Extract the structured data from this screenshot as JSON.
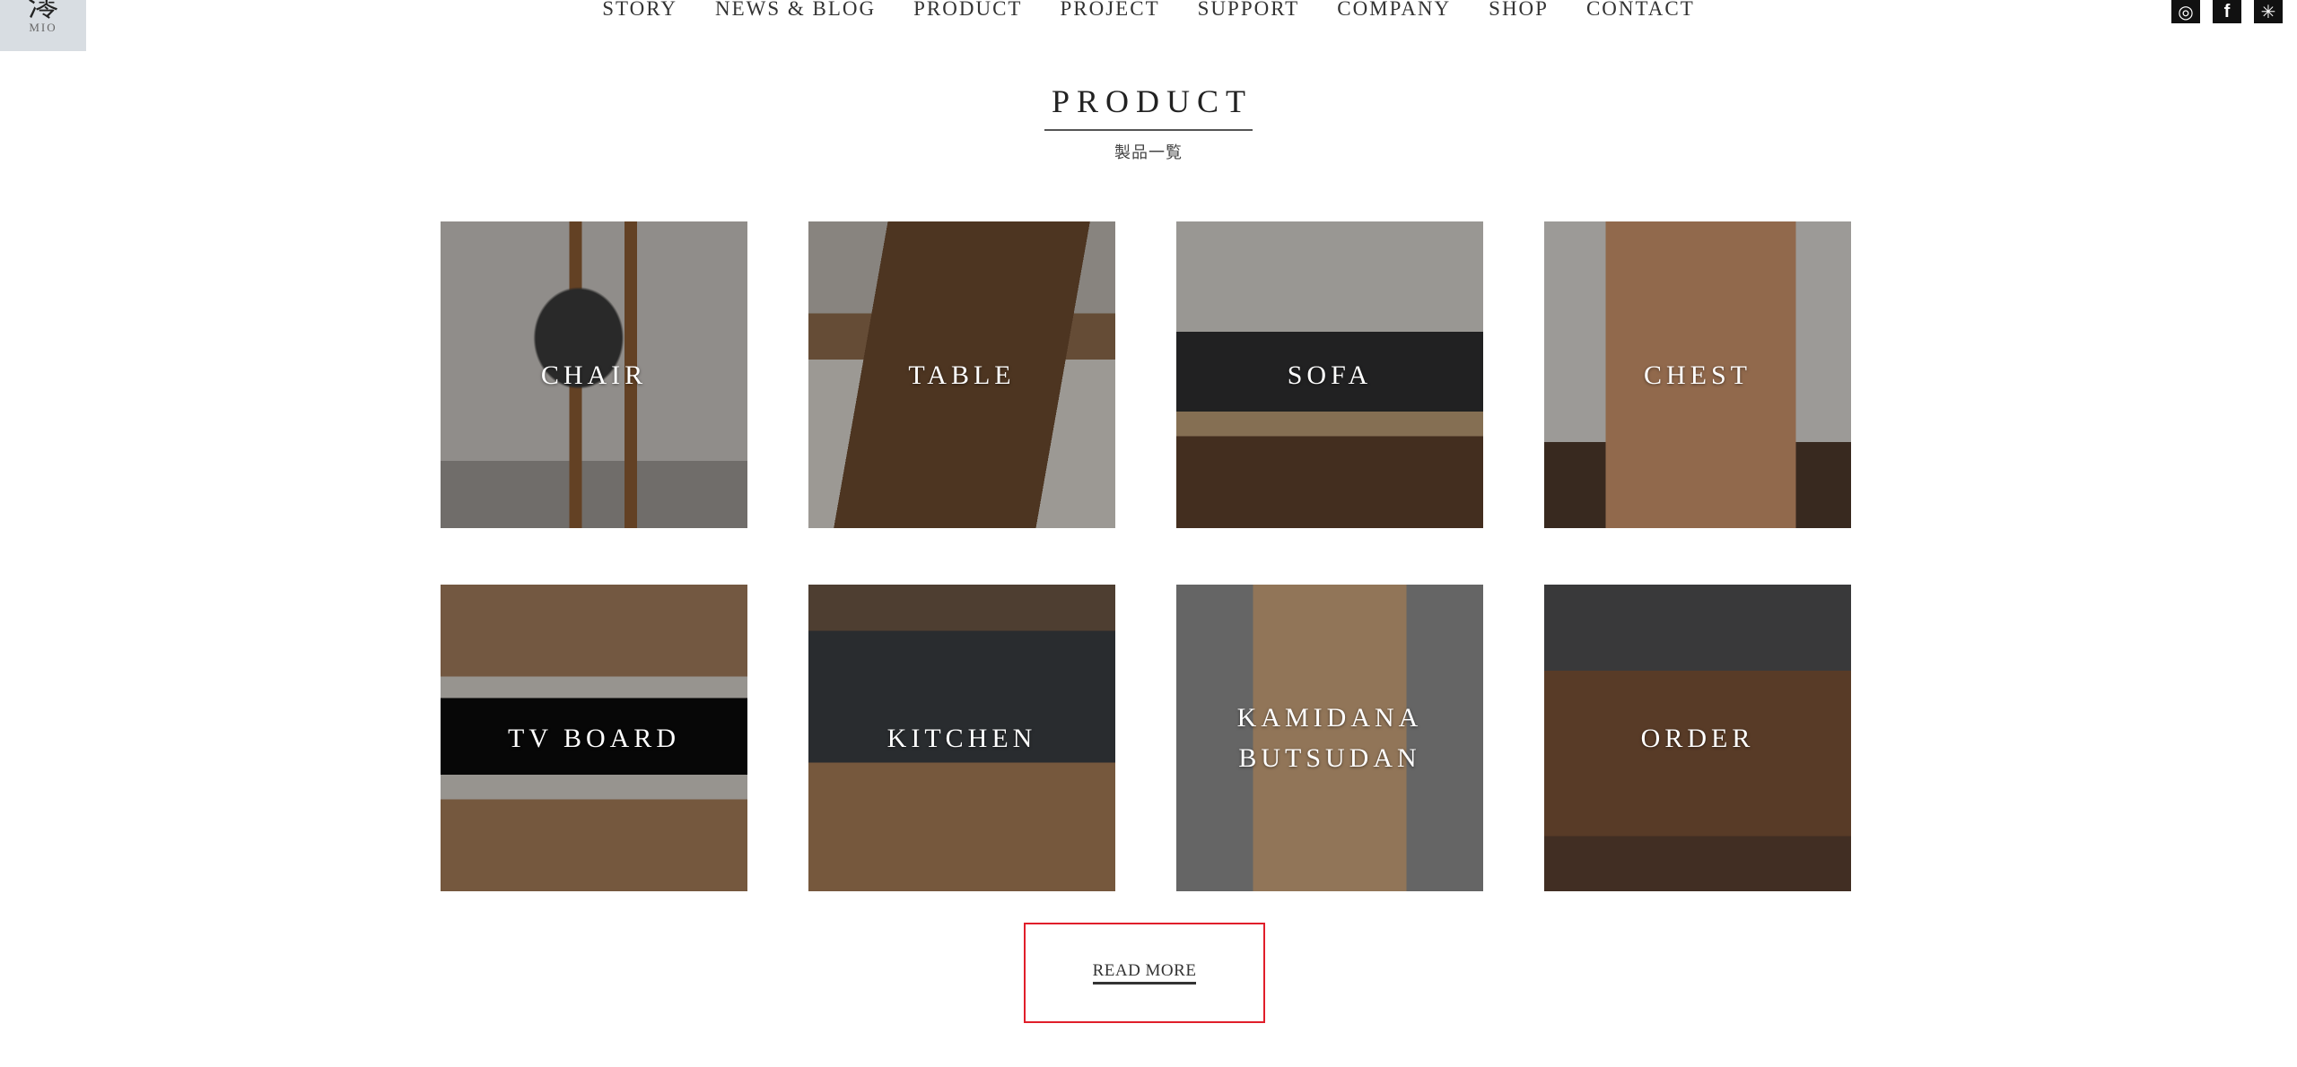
{
  "logo": {
    "mark": "澪",
    "sub": "MIO"
  },
  "nav": [
    "STORY",
    "NEWS & BLOG",
    "PRODUCT",
    "PROJECT",
    "SUPPORT",
    "COMPANY",
    "SHOP",
    "CONTACT"
  ],
  "social": [
    {
      "icon": "instagram-icon",
      "glyph": "◎"
    },
    {
      "icon": "facebook-icon",
      "glyph": "f"
    },
    {
      "icon": "snowflake-icon",
      "glyph": "✳"
    }
  ],
  "section": {
    "title": "PRODUCT",
    "subtitle": "製品一覧"
  },
  "products": [
    {
      "label": "CHAIR",
      "style": "p1"
    },
    {
      "label": "TABLE",
      "style": "p2"
    },
    {
      "label": "SOFA",
      "style": "p3"
    },
    {
      "label": "CHEST",
      "style": "p4"
    },
    {
      "label": "TV BOARD",
      "style": "p5"
    },
    {
      "label": "KITCHEN",
      "style": "p6"
    },
    {
      "label": "KAMIDANA\nBUTSUDAN",
      "style": "p7"
    },
    {
      "label": "ORDER",
      "style": "p8"
    }
  ],
  "read_more": "READ MORE"
}
